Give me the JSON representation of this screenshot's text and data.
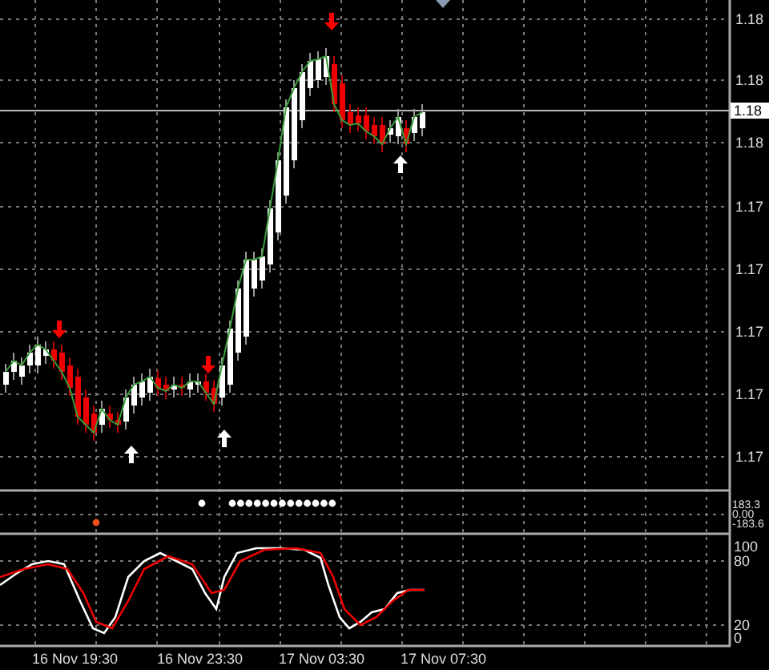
{
  "price_axis": {
    "labels": [
      "1.18",
      "1.18",
      "1.18",
      "1.17",
      "1.17",
      "1.17",
      "1.17",
      "1.17"
    ],
    "current_price": "1.18"
  },
  "signal_panel": {
    "labels": [
      "183.3",
      "0.00",
      "-183.6"
    ]
  },
  "stochastic_panel": {
    "labels": [
      "100",
      "80",
      "20",
      "0"
    ]
  },
  "time_axis": {
    "labels": [
      "16 Nov 19:30",
      "16 Nov 23:30",
      "17 Nov 03:30",
      "17 Nov 07:30"
    ]
  }
}
